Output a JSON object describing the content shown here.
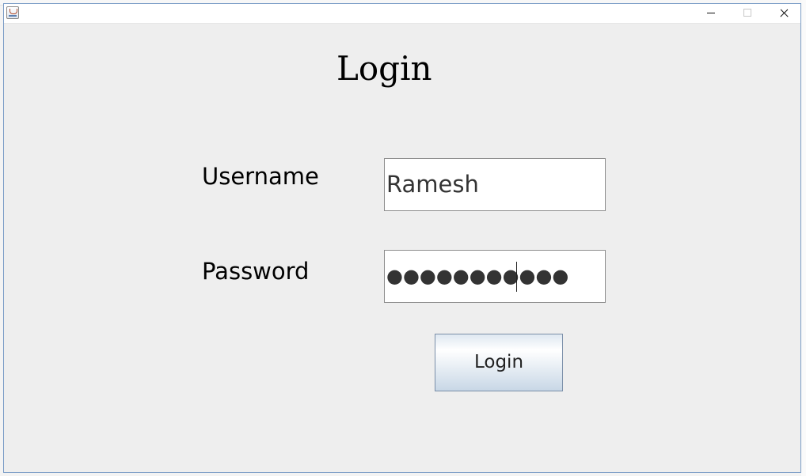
{
  "window": {
    "title": ""
  },
  "form": {
    "heading": "Login",
    "username_label": "Username",
    "username_value": "Ramesh",
    "password_label": "Password",
    "password_masked": "●●●●●●●●●●●",
    "login_button": "Login"
  },
  "icons": {
    "app": "java-cup-icon",
    "minimize": "minimize-icon",
    "maximize": "maximize-icon",
    "close": "close-icon"
  }
}
